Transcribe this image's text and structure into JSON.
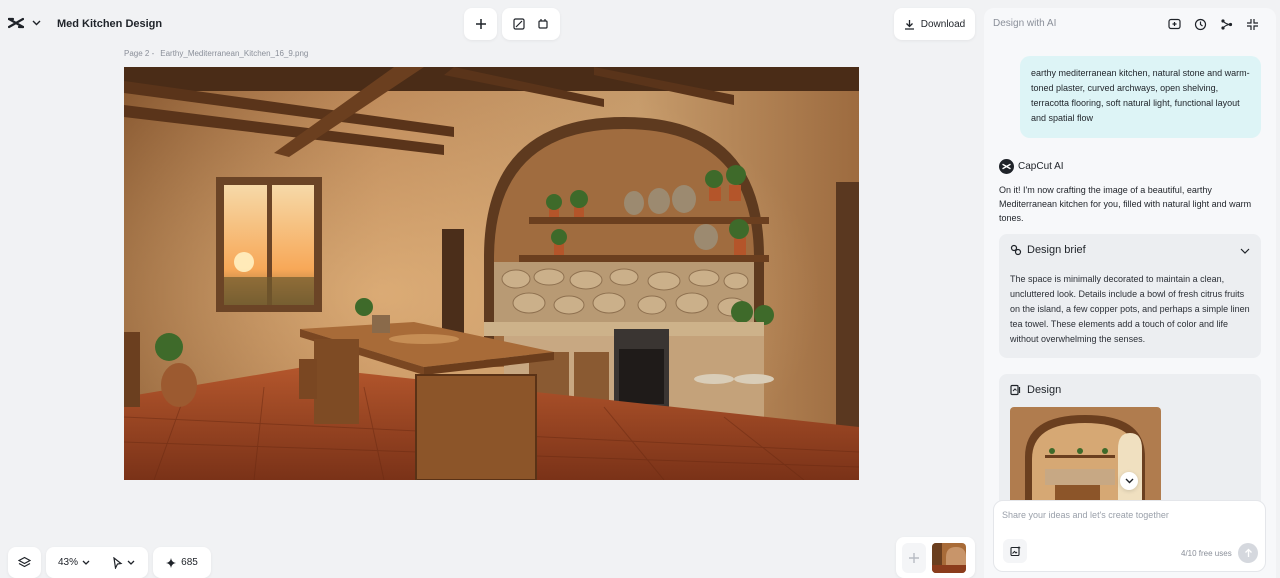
{
  "header": {
    "project_title": "Med Kitchen Design",
    "download_label": "Download"
  },
  "canvas": {
    "page_label": "Page 2 -",
    "file_name": "Earthy_Mediterranean_Kitchen_16_9.png"
  },
  "bottom_bar": {
    "zoom_label": "43%",
    "credits": "685"
  },
  "panel": {
    "title": "Design with AI",
    "user_prompt": "earthy mediterranean kitchen, natural stone and warm-toned plaster, curved archways, open shelving, terracotta flooring, soft natural light, functional layout and spatial flow",
    "ai_name": "CapCut AI",
    "ai_reply": "On it! I'm now crafting the image of a beautiful, earthy Mediterranean kitchen for you, filled with natural light and warm tones.",
    "brief": {
      "title": "Design brief",
      "text": "The space is minimally decorated to maintain a clean, uncluttered look. Details include a bowl of fresh citrus fruits on the island, a few copper pots, and perhaps a simple linen tea towel. These elements add a touch of color and life without overwhelming the senses."
    },
    "design": {
      "title": "Design"
    },
    "composer": {
      "placeholder": "Share your ideas and let's create together",
      "usage": "4/10 free uses"
    }
  },
  "colors": {
    "user_bubble": "#ddf4f6",
    "card_bg": "#eceef1",
    "canvas_bg": "#f1f2f4"
  }
}
